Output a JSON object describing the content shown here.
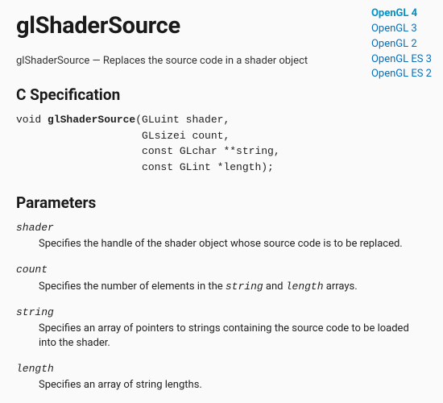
{
  "versions": [
    {
      "label": "OpenGL 4",
      "active": true
    },
    {
      "label": "OpenGL 3",
      "active": false
    },
    {
      "label": "OpenGL 2",
      "active": false
    },
    {
      "label": "OpenGL ES 3",
      "active": false
    },
    {
      "label": "OpenGL ES 2",
      "active": false
    }
  ],
  "title": "glShaderSource",
  "summary": "glShaderSource — Replaces the source code in a shader object",
  "sections": {
    "spec_heading": "C Specification",
    "params_heading": "Parameters"
  },
  "func": {
    "ret": "void",
    "name": "glShaderSource",
    "args": [
      "GLuint shader,",
      "GLsizei count,",
      "const GLchar **string,",
      "const GLint *length);"
    ]
  },
  "parameters": [
    {
      "name": "shader",
      "desc_parts": [
        {
          "t": "Specifies the handle of the shader object whose source code is to be replaced."
        }
      ]
    },
    {
      "name": "count",
      "desc_parts": [
        {
          "t": "Specifies the number of elements in the "
        },
        {
          "t": "string",
          "code": true
        },
        {
          "t": " and "
        },
        {
          "t": "length",
          "code": true
        },
        {
          "t": " arrays."
        }
      ]
    },
    {
      "name": "string",
      "desc_parts": [
        {
          "t": "Specifies an array of pointers to strings containing the source code to be loaded into the shader."
        }
      ]
    },
    {
      "name": "length",
      "desc_parts": [
        {
          "t": "Specifies an array of string lengths."
        }
      ]
    }
  ]
}
